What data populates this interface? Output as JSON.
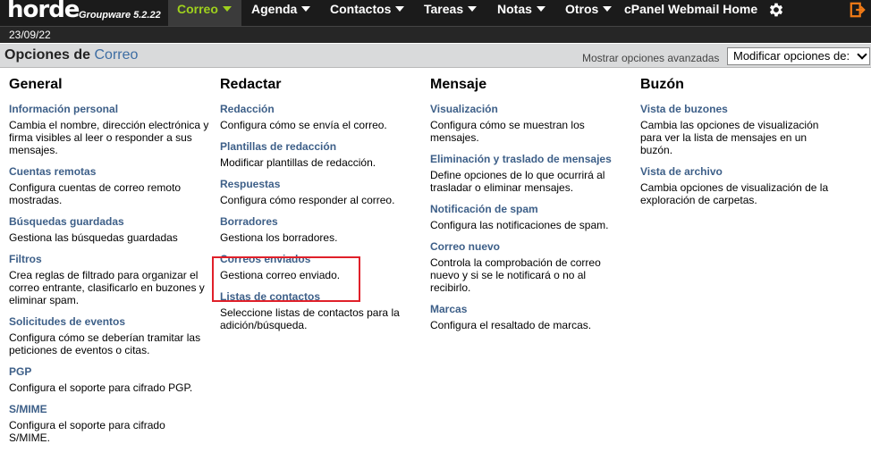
{
  "header": {
    "logo_text": "horde",
    "version": "Groupware 5.2.22",
    "nav": [
      {
        "label": "Correo",
        "active": true,
        "dropdown": true
      },
      {
        "label": "Agenda",
        "active": false,
        "dropdown": true
      },
      {
        "label": "Contactos",
        "active": false,
        "dropdown": true
      },
      {
        "label": "Tareas",
        "active": false,
        "dropdown": true
      },
      {
        "label": "Notas",
        "active": false,
        "dropdown": true
      },
      {
        "label": "Otros",
        "active": false,
        "dropdown": true
      },
      {
        "label": "cPanel Webmail Home",
        "active": false,
        "dropdown": false
      }
    ],
    "settings_icon": "gear-icon",
    "logout_icon": "logout-icon"
  },
  "date": "23/09/22",
  "options_bar": {
    "title_prefix": "Opciones de",
    "title_app": "Correo",
    "advanced_link": "Mostrar opciones avanzadas",
    "select_value": "Modificar opciones de:"
  },
  "columns": [
    {
      "heading": "General",
      "entries": [
        {
          "title": "Información personal",
          "desc": "Cambia el nombre, dirección electrónica y firma visibles al leer o responder a sus mensajes."
        },
        {
          "title": "Cuentas remotas",
          "desc": "Configura cuentas de correo remoto mostradas."
        },
        {
          "title": "Búsquedas guardadas",
          "desc": "Gestiona las búsquedas guardadas"
        },
        {
          "title": "Filtros",
          "desc": "Crea reglas de filtrado para organizar el correo entrante, clasificarlo en buzones y eliminar spam."
        },
        {
          "title": "Solicitudes de eventos",
          "desc": "Configura cómo se deberían tramitar las peticiones de eventos o citas."
        },
        {
          "title": "PGP",
          "desc": "Configura el soporte para cifrado PGP."
        },
        {
          "title": "S/MIME",
          "desc": "Configura el soporte para cifrado S/MIME."
        }
      ]
    },
    {
      "heading": "Redactar",
      "entries": [
        {
          "title": "Redacción",
          "desc": "Configura cómo se envía el correo."
        },
        {
          "title": "Plantillas de redacción",
          "desc": "Modificar plantillas de redacción."
        },
        {
          "title": "Respuestas",
          "desc": "Configura cómo responder al correo."
        },
        {
          "title": "Borradores",
          "desc": "Gestiona los borradores."
        },
        {
          "title": "Correos enviados",
          "desc": "Gestiona correo enviado."
        },
        {
          "title": "Listas de contactos",
          "desc": "Seleccione listas de contactos para la adición/búsqueda."
        }
      ]
    },
    {
      "heading": "Mensaje",
      "entries": [
        {
          "title": "Visualización",
          "desc": "Configura cómo se muestran los mensajes."
        },
        {
          "title": "Eliminación y traslado de mensajes",
          "desc": "Define opciones de lo que ocurrirá al trasladar o eliminar mensajes."
        },
        {
          "title": "Notificación de spam",
          "desc": "Configura las notificaciones de spam."
        },
        {
          "title": "Correo nuevo",
          "desc": "Controla la comprobación de correo nuevo y si se le notificará o no al recibirlo."
        },
        {
          "title": "Marcas",
          "desc": "Configura el resaltado de marcas."
        }
      ]
    },
    {
      "heading": "Buzón",
      "entries": [
        {
          "title": "Vista de buzones",
          "desc": "Cambia las opciones de visualización para ver la lista de mensajes en un buzón."
        },
        {
          "title": "Vista de archivo",
          "desc": "Cambia opciones de visualización de la exploración de carpetas."
        }
      ]
    }
  ],
  "colors": {
    "accent_active": "#9fd11d",
    "link": "#3d5f88",
    "highlight": "#e0202a"
  }
}
